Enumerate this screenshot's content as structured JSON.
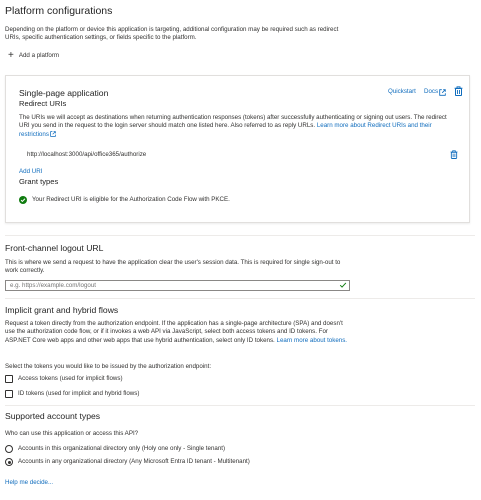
{
  "page": {
    "title": "Platform configurations",
    "intro": "Depending on the platform or device this application is targeting, additional configuration may be required such as redirect URIs, specific authentication settings, or fields specific to the platform.",
    "add_platform": "Add a platform"
  },
  "spa": {
    "title": "Single-page application",
    "quickstart": "Quickstart",
    "docs": "Docs",
    "redirect_title": "Redirect URIs",
    "redirect_desc": "The URIs we will accept as destinations when returning authentication responses (tokens) after successfully authenticating or signing out users. The redirect URI you send in the request to the login server should match one listed here. Also referred to as reply URLs.",
    "redirect_link": "Learn more about Redirect URIs and their restrictions",
    "uri_value": "http://localhost:3000/api/office365/authorize",
    "add_uri": "Add URI",
    "grant_title": "Grant types",
    "grant_status": "Your Redirect URI is eligible for the Authorization Code Flow with PKCE."
  },
  "logout": {
    "title": "Front-channel logout URL",
    "desc": "This is where we send a request to have the application clear the user's session data. This is required for single sign-out to work correctly.",
    "placeholder": "e.g. https://example.com/logout"
  },
  "implicit": {
    "title": "Implicit grant and hybrid flows",
    "desc": "Request a token directly from the authorization endpoint. If the application has a single-page architecture (SPA) and doesn't use the authorization code flow, or if it invokes a web API via JavaScript, select both access tokens and ID tokens. For ASP.NET Core web apps and other web apps that use hybrid authentication, select only ID tokens.",
    "link": "Learn more about tokens.",
    "select_label": "Select the tokens you would like to be issued by the authorization endpoint:",
    "access_tokens": "Access tokens (used for implicit flows)",
    "id_tokens": "ID tokens (used for implicit and hybrid flows)",
    "access_checked": false,
    "id_checked": false
  },
  "accounts": {
    "title": "Supported account types",
    "question": "Who can use this application or access this API?",
    "option_single": "Accounts in this organizational directory only (Holy one only - Single tenant)",
    "option_multi": "Accounts in any organizational directory (Any Microsoft Entra ID tenant - Multitenant)",
    "selected": "multi",
    "help": "Help me decide..."
  },
  "colors": {
    "accent": "#0f6cbd",
    "success": "#107c10",
    "text": "#323130"
  }
}
